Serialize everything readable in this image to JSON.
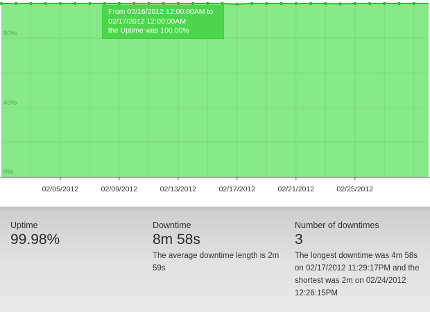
{
  "chart_data": {
    "type": "area",
    "ylim": [
      0,
      100
    ],
    "y_ticks": [
      {
        "value": 0,
        "label": "0%"
      },
      {
        "value": 40,
        "label": "40%"
      },
      {
        "value": 80,
        "label": "80%"
      }
    ],
    "x_range": [
      "2012-02-01",
      "2012-03-01"
    ],
    "x_ticks": [
      {
        "date": "2012-02-05",
        "label": "02/05/2012"
      },
      {
        "date": "2012-02-09",
        "label": "02/09/2012"
      },
      {
        "date": "2012-02-13",
        "label": "02/13/2012"
      },
      {
        "date": "2012-02-17",
        "label": "02/17/2012"
      },
      {
        "date": "2012-02-21",
        "label": "02/21/2012"
      },
      {
        "date": "2012-02-25",
        "label": "02/25/2012"
      }
    ],
    "x": [
      "2012-02-01",
      "2012-02-02",
      "2012-02-03",
      "2012-02-04",
      "2012-02-05",
      "2012-02-06",
      "2012-02-07",
      "2012-02-08",
      "2012-02-09",
      "2012-02-10",
      "2012-02-11",
      "2012-02-12",
      "2012-02-13",
      "2012-02-14",
      "2012-02-15",
      "2012-02-16",
      "2012-02-17",
      "2012-02-18",
      "2012-02-19",
      "2012-02-20",
      "2012-02-21",
      "2012-02-22",
      "2012-02-23",
      "2012-02-24",
      "2012-02-25",
      "2012-02-26",
      "2012-02-27",
      "2012-02-28",
      "2012-02-29"
    ],
    "series": [
      {
        "values": [
          100,
          100,
          100,
          100,
          100,
          100,
          100,
          100,
          100,
          100,
          100,
          100,
          100,
          100,
          100,
          100,
          99.6,
          100,
          100,
          100,
          100,
          100,
          100,
          99.8,
          100,
          100,
          100,
          100,
          100
        ]
      }
    ],
    "colors": {
      "fill": "#86e886",
      "line": "#33bb33",
      "grid": "#74d474",
      "tooltip": "#4cd64c"
    },
    "grid": true,
    "tooltip": {
      "lines": [
        "From 02/16/2012 12:00:00AM to",
        "02/17/2012 12:00:00AM",
        "the Uptime was 100.00%"
      ]
    }
  },
  "stats": {
    "uptime": {
      "label": "Uptime",
      "value": "99.98%"
    },
    "downtime": {
      "label": "Downtime",
      "value": "8m 58s",
      "note": "The average downtime length is 2m 59s"
    },
    "count": {
      "label": "Number of downtimes",
      "value": "3",
      "note": "The longest downtime was 4m 58s on 02/17/2012 11:29:17PM and the shortest was 2m on 02/24/2012 12:26:15PM"
    }
  }
}
